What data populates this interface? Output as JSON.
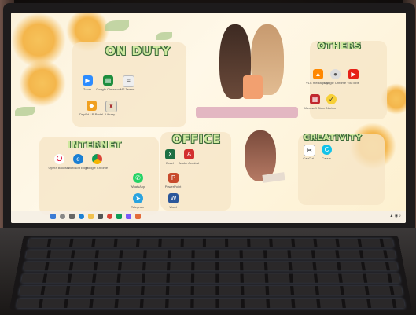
{
  "desktop": {
    "groups": {
      "on_duty": {
        "title": "ON DUTY",
        "apps": [
          "Zoom",
          "Google Classroom",
          "MS Teams",
          "DepEd LR Portal",
          "LIS",
          "Library"
        ]
      },
      "others": {
        "title": "OTHERS",
        "apps": [
          "VLC media player",
          "Google Chrome",
          "YouTube",
          "Microsoft Store",
          "Norton"
        ]
      },
      "internet": {
        "title": "INTERNET",
        "apps": [
          "Opera Browser",
          "Microsoft Edge",
          "Google Chrome"
        ]
      },
      "office": {
        "title": "OFFICE",
        "apps": [
          "Excel",
          "Adobe Acrobat",
          "WhatsApp",
          "PowerPoint",
          "Telegram",
          "Word"
        ]
      },
      "creativity": {
        "title": "CREATIVITY",
        "apps": [
          "CapCut",
          "Canva"
        ]
      }
    },
    "icons": {
      "zoom": "video-icon",
      "classroom": "classroom-icon",
      "teams": "teams-icon",
      "vlc": "cone-icon",
      "youtube": "play-icon",
      "opera": "opera-icon",
      "edge": "edge-icon",
      "chrome": "chrome-icon",
      "excel": "excel-icon",
      "acrobat": "pdf-icon",
      "whatsapp": "whatsapp-icon",
      "word": "word-icon",
      "powerpoint": "ppt-icon",
      "telegram": "telegram-icon"
    }
  },
  "colors": {
    "title_fill": "#cfe8a0",
    "title_outline": "#3c6b3a",
    "panel": "#f6e5c6",
    "flower": "#f4b64c"
  }
}
